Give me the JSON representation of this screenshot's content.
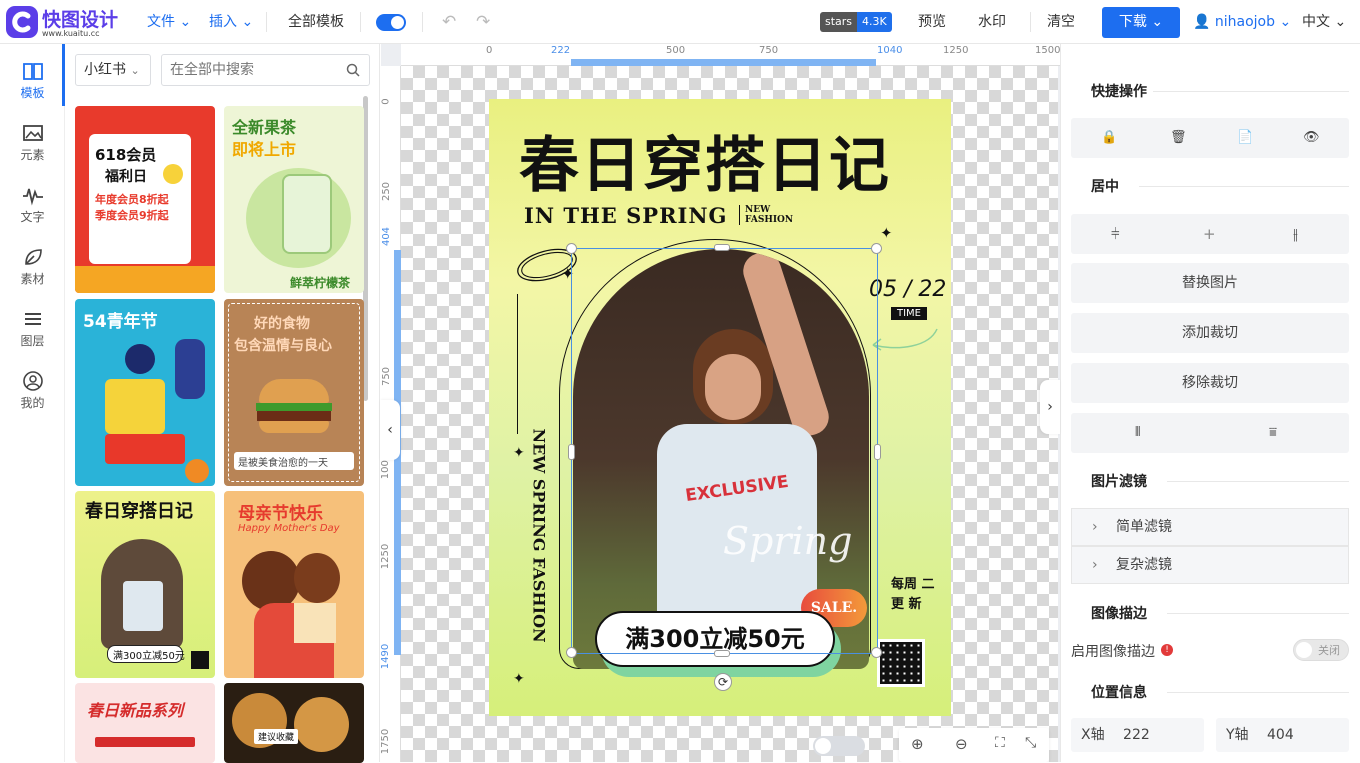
{
  "header": {
    "logo_title": "快图设计",
    "logo_url": "www.kuaitu.cc",
    "menu_file": "文件",
    "menu_insert": "插入",
    "all_templates": "全部模板",
    "stars_label": "stars",
    "stars_count": "4.3K",
    "preview": "预览",
    "watermark": "水印",
    "clear": "清空",
    "download": "下载",
    "username": "nihaojob",
    "language": "中文"
  },
  "leftnav": {
    "items": [
      {
        "label": "模板",
        "icon": "book-icon"
      },
      {
        "label": "元素",
        "icon": "image-icon"
      },
      {
        "label": "文字",
        "icon": "wave-icon"
      },
      {
        "label": "素材",
        "icon": "leaf-icon"
      },
      {
        "label": "图层",
        "icon": "layers-icon"
      },
      {
        "label": "我的",
        "icon": "user-icon"
      }
    ]
  },
  "templates": {
    "category": "小红书",
    "search_placeholder": "在全部中搜索",
    "cards": [
      {
        "lines": [
          "618会员",
          "福利日",
          "年度会员8折起",
          "季度会员9折起"
        ]
      },
      {
        "lines": [
          "全新果茶",
          "即将上市",
          "鲜萃柠檬茶"
        ]
      },
      {
        "lines": [
          "54青年节"
        ]
      },
      {
        "lines": [
          "好的食物",
          "包含温情与良心",
          "是被美食治愈的一天"
        ]
      },
      {
        "lines": [
          "春日穿搭日记",
          "满300立减50元"
        ]
      },
      {
        "lines": [
          "母亲节快乐",
          "Happy Mother's Day"
        ]
      },
      {
        "lines": [
          "春日新品系列"
        ]
      },
      {
        "lines": [
          "建议收藏"
        ]
      }
    ]
  },
  "ruler": {
    "top": [
      "0",
      "222",
      "500",
      "750",
      "1040",
      "1250",
      "1500"
    ],
    "left": [
      "0",
      "250",
      "404",
      "750",
      "1000",
      "1250",
      "1490",
      "1750"
    ]
  },
  "poster": {
    "title": "春日穿搭日记",
    "subtitle": "IN THE SPRING",
    "new_fashion": "NEW\nFASHION",
    "date": "05 / 22",
    "time_tag": "TIME",
    "vertical_text": "NEW SPRING FASHION",
    "weekly": "每周 二\n更 新",
    "sale": "SALE.",
    "promo": "满300立减50元",
    "script_word": "Spring",
    "shirt_text": "EXCLUSIVE"
  },
  "rightpanel": {
    "quick_ops": "快捷操作",
    "center": "居中",
    "replace_image": "替换图片",
    "add_crop": "添加裁切",
    "remove_crop": "移除裁切",
    "image_filter": "图片滤镜",
    "simple_filter": "简单滤镜",
    "complex_filter": "复杂滤镜",
    "image_stroke": "图像描边",
    "enable_stroke": "启用图像描边",
    "toggle_off": "关闭",
    "position_info": "位置信息",
    "x_label": "X轴",
    "x_value": "222",
    "y_label": "Y轴",
    "y_value": "404"
  },
  "colors": {
    "accent": "#1d6ef0",
    "logo": "#5b3ee8"
  }
}
